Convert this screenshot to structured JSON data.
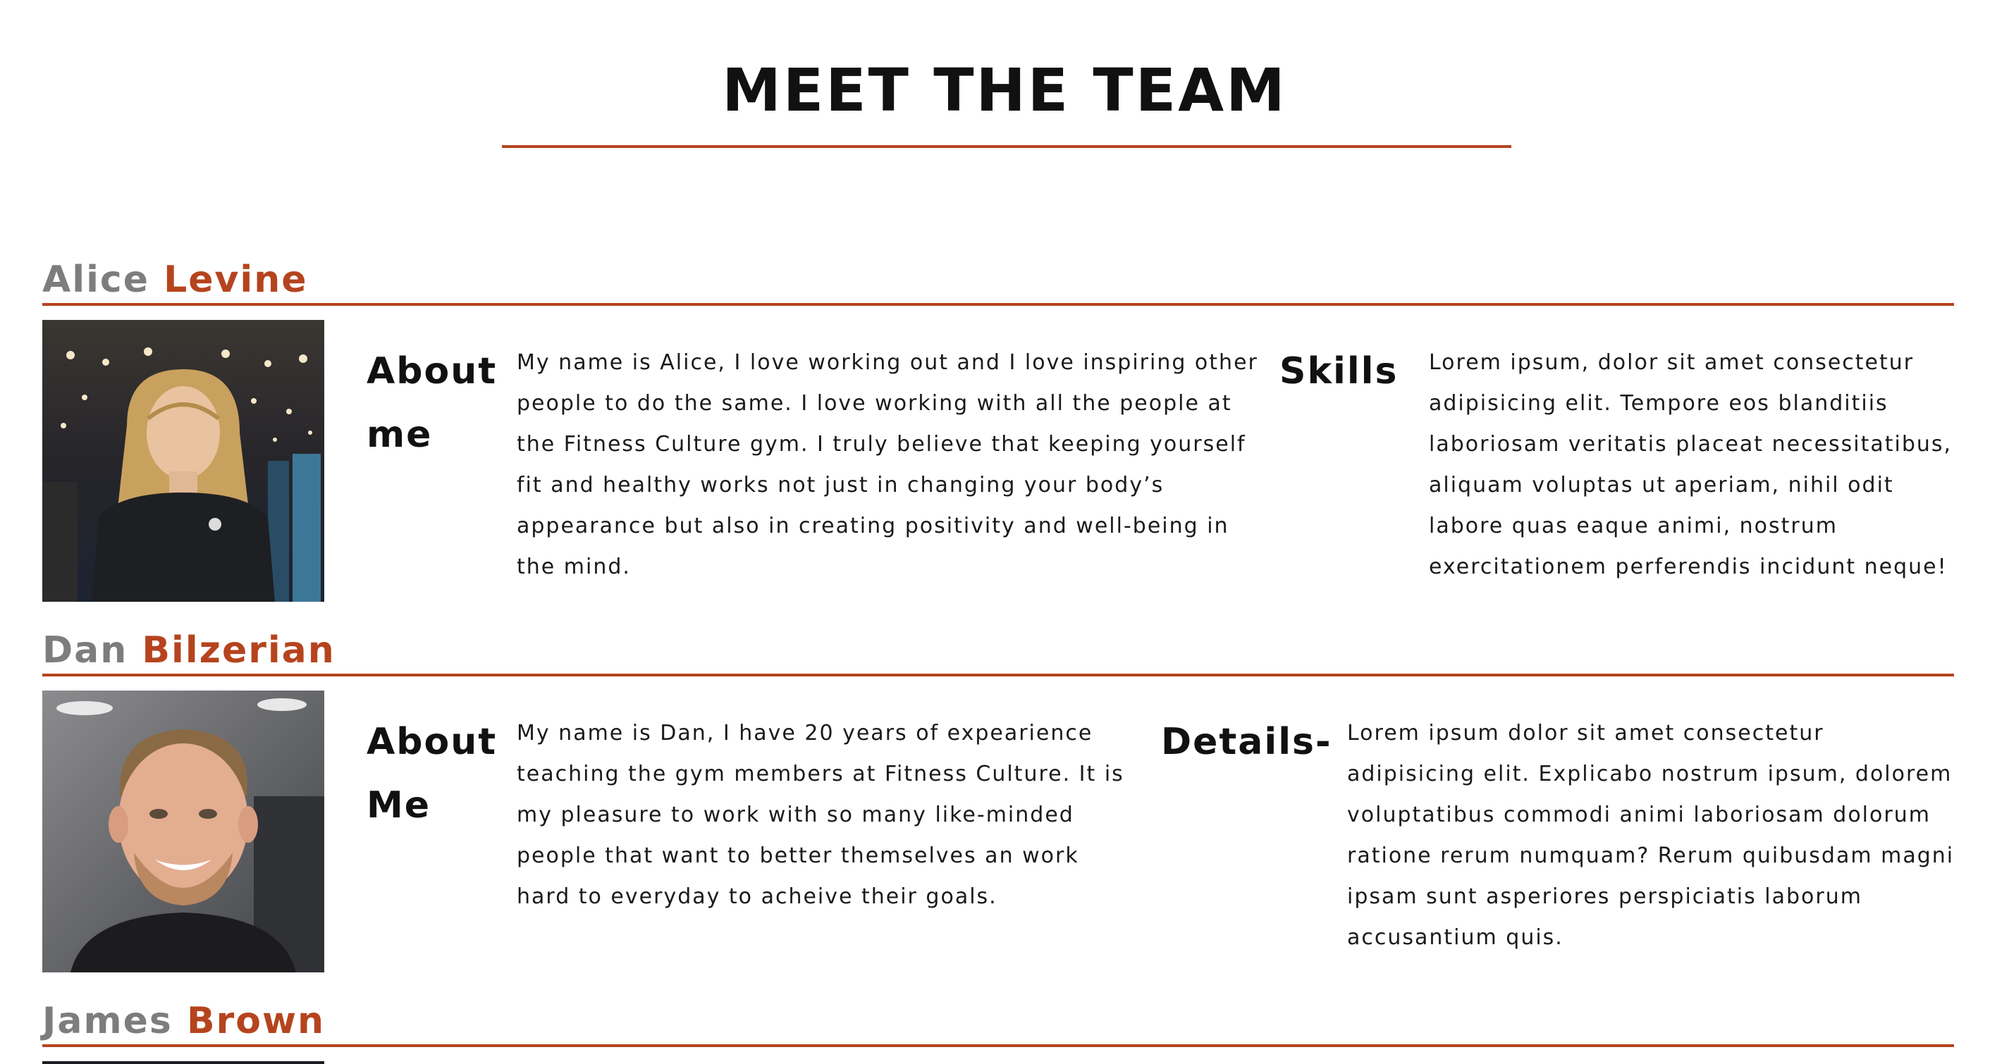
{
  "page": {
    "title": "MEET THE TEAM"
  },
  "colors": {
    "accent": "#b5441e",
    "first_name": "#7d7d7d",
    "text": "#111111",
    "background": "#ffffff"
  },
  "members": [
    {
      "first_name": "Alice",
      "last_name": "Levine",
      "photo_icon": "person-photo",
      "about_label": "About me",
      "about_text": "My name is Alice, I love working out and I love inspiring other people to do the same. I love working with all the people at the Fitness Culture gym. I truly believe that keeping yourself fit and healthy works not just in changing your body’s appearance but also in creating positivity and well-being in the mind.",
      "side_label": "Skills",
      "side_text": "Lorem ipsum, dolor sit amet consectetur adipisicing elit. Tempore eos blanditiis laboriosam veritatis placeat necessitatibus, aliquam voluptas ut aperiam, nihil odit labore quas eaque animi, nostrum exercitationem perferendis incidunt neque!"
    },
    {
      "first_name": "Dan",
      "last_name": "Bilzerian",
      "photo_icon": "person-photo",
      "about_label": "About Me",
      "about_text": "My name is Dan, I have 20 years of expearience teaching the gym members at Fitness Culture. It is my pleasure to work with so many like-minded people that want to better themselves an work hard to everyday to acheive their goals.",
      "side_label": "Details-",
      "side_text": "Lorem ipsum dolor sit amet consectetur adipisicing elit. Explicabo nostrum ipsum, dolorem voluptatibus commodi animi laboriosam dolorum ratione rerum numquam? Rerum quibusdam magni ipsam sunt asperiores perspiciatis laborum accusantium quis."
    },
    {
      "first_name": "James",
      "last_name": "Brown",
      "photo_icon": "person-photo"
    }
  ]
}
